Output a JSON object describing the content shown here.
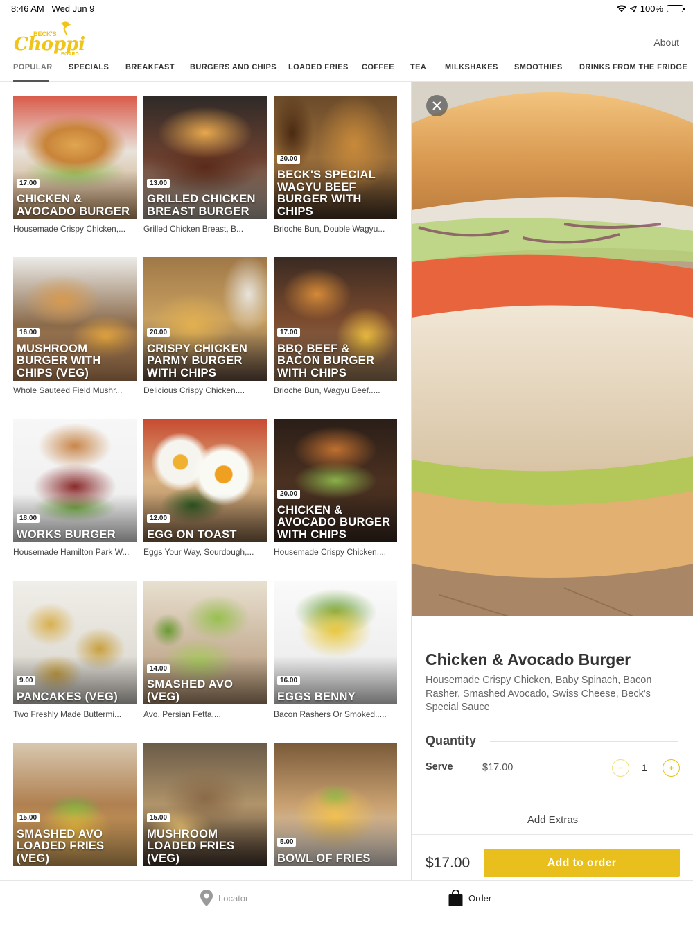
{
  "status_bar": {
    "time": "8:46 AM",
    "date": "Wed Jun 9",
    "battery": "100%"
  },
  "header": {
    "logo_text": "Beck's Chopping Board",
    "about": "About"
  },
  "categories": [
    "POPULAR",
    "SPECIALS",
    "BREAKFAST",
    "BURGERS AND CHIPS",
    "LOADED FRIES",
    "COFFEE",
    "TEA",
    "MILKSHAKES",
    "SMOOTHIES",
    "DRINKS FROM THE FRIDGE"
  ],
  "active_category": "POPULAR",
  "menu_items": [
    {
      "price": "17.00",
      "name": "CHICKEN & AVOCADO BURGER",
      "desc": "Housemade Crispy Chicken,..."
    },
    {
      "price": "13.00",
      "name": "GRILLED CHICKEN BREAST BURGER",
      "desc": "Grilled Chicken Breast, B..."
    },
    {
      "price": "20.00",
      "name": "BECK'S SPECIAL WAGYU BEEF BURGER WITH CHIPS",
      "desc": "Brioche Bun, Double Wagyu..."
    },
    {
      "price": "16.00",
      "name": "MUSHROOM BURGER WITH CHIPS (VEG)",
      "desc": "Whole Sauteed Field Mushr..."
    },
    {
      "price": "20.00",
      "name": "CRISPY CHICKEN PARMY BURGER WITH CHIPS",
      "desc": "Delicious Crispy Chicken...."
    },
    {
      "price": "17.00",
      "name": "BBQ BEEF & BACON BURGER WITH CHIPS",
      "desc": "Brioche Bun, Wagyu Beef....."
    },
    {
      "price": "18.00",
      "name": "WORKS BURGER",
      "desc": "Housemade Hamilton Park W..."
    },
    {
      "price": "12.00",
      "name": "EGG ON TOAST",
      "desc": "Eggs Your Way, Sourdough,..."
    },
    {
      "price": "20.00",
      "name": "CHICKEN & AVOCADO BURGER WITH CHIPS",
      "desc": "Housemade Crispy Chicken,..."
    },
    {
      "price": "9.00",
      "name": "PANCAKES (VEG)",
      "desc": "Two Freshly Made Buttermi..."
    },
    {
      "price": "14.00",
      "name": "SMASHED AVO (VEG)",
      "desc": "Avo, Persian Fetta,..."
    },
    {
      "price": "16.00",
      "name": "EGGS BENNY",
      "desc": "Bacon Rashers Or Smoked....."
    },
    {
      "price": "15.00",
      "name": "SMASHED AVO LOADED FRIES (VEG)",
      "desc": ""
    },
    {
      "price": "15.00",
      "name": "MUSHROOM LOADED FRIES (VEG)",
      "desc": ""
    },
    {
      "price": "5.00",
      "name": "BOWL OF FRIES",
      "desc": ""
    }
  ],
  "detail": {
    "title": "Chicken & Avocado Burger",
    "description": "Housemade Crispy Chicken, Baby Spinach, Bacon Rasher, Smashed Avocado, Swiss Cheese, Beck's Special Sauce",
    "quantity_label": "Quantity",
    "serve_label": "Serve",
    "serve_price": "$17.00",
    "quantity": "1",
    "add_extras": "Add Extras",
    "total": "$17.00",
    "add_to_order": "Add to order"
  },
  "bottom_bar": {
    "locator": "Locator",
    "order": "Order"
  },
  "colors": {
    "accent": "#e8bf1c",
    "logo": "#f0c419"
  }
}
